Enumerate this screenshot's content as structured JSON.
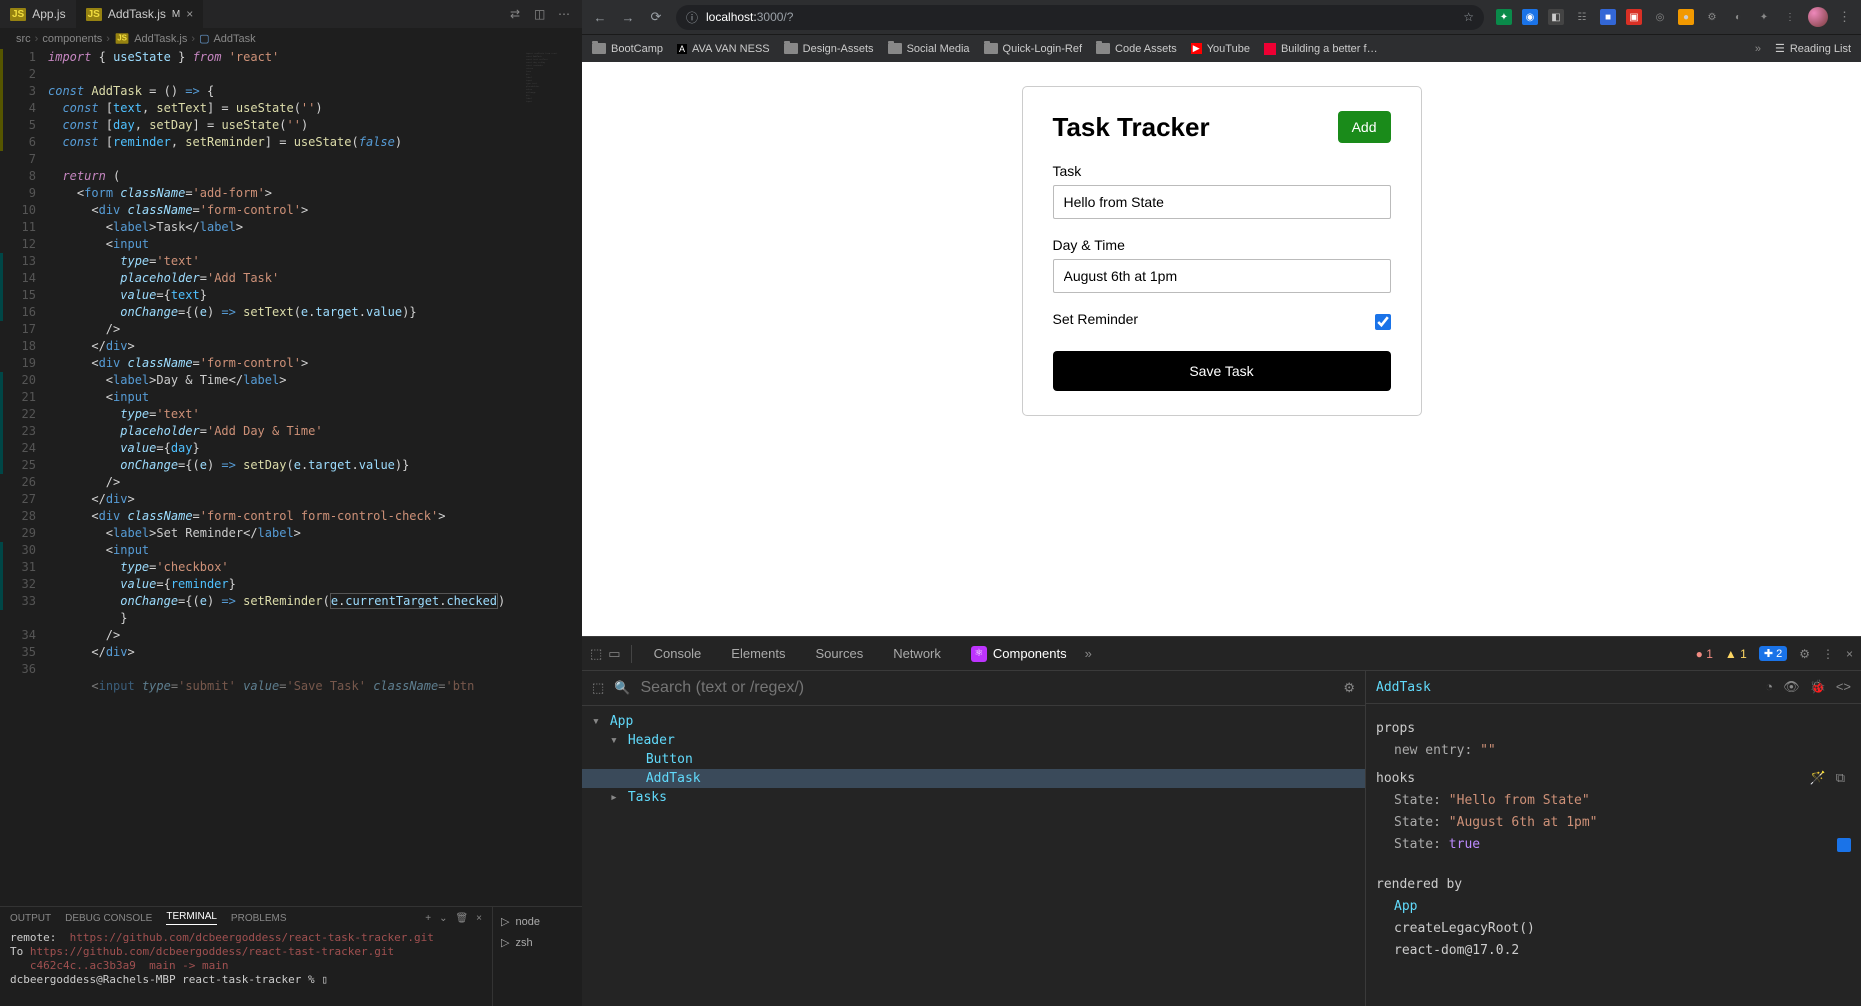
{
  "vscode": {
    "tabs": [
      {
        "name": "App.js",
        "icon": "JS",
        "active": false
      },
      {
        "name": "AddTask.js",
        "icon": "JS",
        "modified": "M",
        "active": true
      }
    ],
    "breadcrumb": [
      "src",
      "components",
      "AddTask.js",
      "AddTask"
    ],
    "lines": [
      1,
      2,
      3,
      4,
      5,
      6,
      7,
      8,
      9,
      10,
      11,
      12,
      13,
      14,
      15,
      16,
      17,
      18,
      19,
      20,
      21,
      22,
      23,
      24,
      25,
      26,
      27,
      28,
      29,
      30,
      31,
      32,
      33,
      "",
      34,
      35,
      36,
      ""
    ],
    "terminal_tabs": [
      "OUTPUT",
      "DEBUG CONSOLE",
      "TERMINAL",
      "PROBLEMS"
    ],
    "terminal_active": "TERMINAL",
    "terminal_lines": [
      {
        "prefix": "remote:",
        "rest": "  https://github.com/dcbeergoddess/react-task-tracker.git"
      },
      {
        "prefix": "To",
        "rest": " https://github.com/dcbeergoddess/react-tast-tracker.git"
      },
      {
        "prefix": "",
        "rest": "   c462c4c..ac3b3a9  main -> main"
      },
      {
        "prefix": "",
        "rest": "dcbeergoddess@Rachels-MBP react-task-tracker % ▯"
      }
    ],
    "terminal_right": [
      "node",
      "zsh"
    ]
  },
  "browser": {
    "url_prefix": "localhost:",
    "url_rest": "3000/?",
    "bookmarks": [
      "BootCamp",
      "AVA VAN NESS",
      "Design-Assets",
      "Social Media",
      "Quick-Login-Ref",
      "Code Assets",
      "YouTube",
      "Building a better f…"
    ],
    "reading_list": "Reading List"
  },
  "app": {
    "title": "Task Tracker",
    "add_btn": "Add",
    "task_label": "Task",
    "task_value": "Hello from State",
    "day_label": "Day & Time",
    "day_value": "August 6th at 1pm",
    "reminder_label": "Set Reminder",
    "reminder_checked": true,
    "save_btn": "Save Task"
  },
  "devtools": {
    "tabs": [
      "Console",
      "Elements",
      "Sources",
      "Network"
    ],
    "components_tab": "Components",
    "err_count": "1",
    "warn_count": "1",
    "msg_count": "2",
    "search_placeholder": "Search (text or /regex/)",
    "tree": [
      {
        "name": "App",
        "indent": 0,
        "caret": "▾"
      },
      {
        "name": "Header",
        "indent": 1,
        "caret": "▾"
      },
      {
        "name": "Button",
        "indent": 2,
        "caret": ""
      },
      {
        "name": "AddTask",
        "indent": 2,
        "caret": "",
        "selected": true
      },
      {
        "name": "Tasks",
        "indent": 1,
        "caret": "▸"
      }
    ],
    "selected": "AddTask",
    "props_label": "props",
    "props": [
      {
        "k": "new entry",
        "v": "\"\""
      }
    ],
    "hooks_label": "hooks",
    "hooks": [
      {
        "k": "State",
        "v": "\"Hello from State\"",
        "t": "str"
      },
      {
        "k": "State",
        "v": "\"August 6th at 1pm\"",
        "t": "str"
      },
      {
        "k": "State",
        "v": "true",
        "t": "bool"
      }
    ],
    "rendered_label": "rendered by",
    "rendered_by": [
      "App",
      "createLegacyRoot()",
      "react-dom@17.0.2"
    ]
  }
}
